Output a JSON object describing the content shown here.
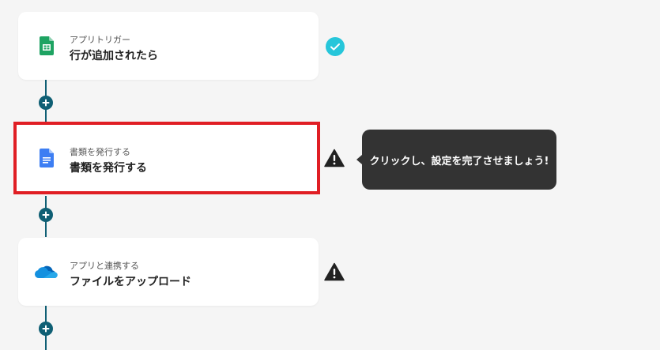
{
  "steps": [
    {
      "subtitle": "アプリトリガー",
      "title": "行が追加されたら",
      "icon": "google-sheets-icon",
      "status": "complete"
    },
    {
      "subtitle": "書類を発行する",
      "title": "書類を発行する",
      "icon": "google-docs-icon",
      "status": "warning",
      "highlighted": true
    },
    {
      "subtitle": "アプリと連携する",
      "title": "ファイルをアップロード",
      "icon": "onedrive-icon",
      "status": "warning"
    }
  ],
  "tooltip": {
    "text": "クリックし、設定を完了させましょう!"
  },
  "colors": {
    "connector": "#0f5f74",
    "highlight_border": "#e01e24",
    "complete": "#26c6da",
    "tooltip_bg": "#333333"
  }
}
